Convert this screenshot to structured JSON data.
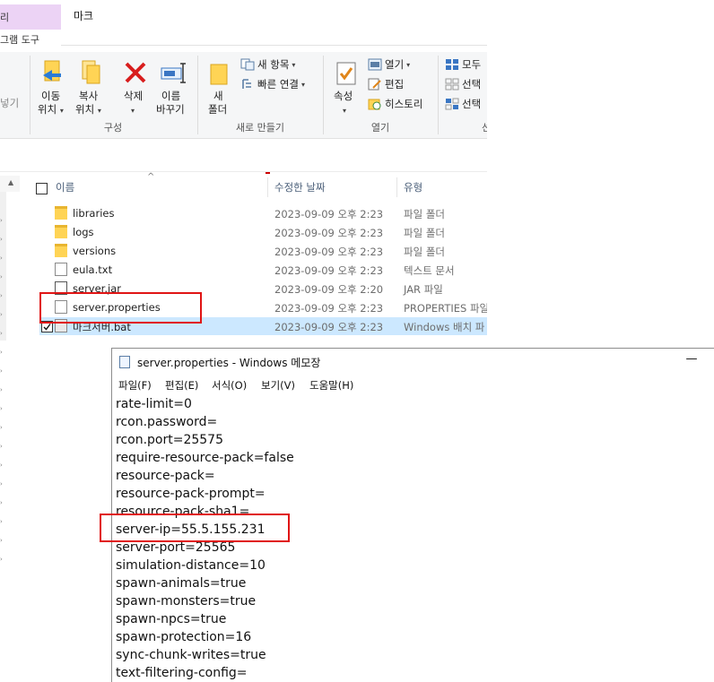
{
  "explorer": {
    "context_tab": {
      "header": "리",
      "label": "그램 도구"
    },
    "title": "마크",
    "ribbon": {
      "partial_left": "넣기",
      "move_to": [
        "이동",
        "위치"
      ],
      "copy_to": [
        "복사",
        "위치"
      ],
      "delete": "삭제",
      "rename": [
        "이름",
        "바꾸기"
      ],
      "new_folder": [
        "새",
        "폴더"
      ],
      "new_item": "새 항목",
      "easy_access": "빠른 연결",
      "properties": "속성",
      "open": "열기",
      "edit": "편집",
      "history": "히스토리",
      "select_all": "모두",
      "select_none": "선택",
      "invert_selection": "선택",
      "groups": {
        "organize": "구성",
        "new": "새로 만들기",
        "open": "열기",
        "select": "선"
      }
    },
    "columns": {
      "name": "이름",
      "date": "수정한 날짜",
      "type": "유형"
    },
    "files": [
      {
        "name": "libraries",
        "date": "2023-09-09 오후 2:23",
        "type": "파일 폴더",
        "icon": "folder-icon"
      },
      {
        "name": "logs",
        "date": "2023-09-09 오후 2:23",
        "type": "파일 폴더",
        "icon": "folder-icon"
      },
      {
        "name": "versions",
        "date": "2023-09-09 오후 2:23",
        "type": "파일 폴더",
        "icon": "folder-icon"
      },
      {
        "name": "eula.txt",
        "date": "2023-09-09 오후 2:23",
        "type": "텍스트 문서",
        "icon": "text-file-icon"
      },
      {
        "name": "server.jar",
        "date": "2023-09-09 오후 2:20",
        "type": "JAR 파일",
        "icon": "jar-file-icon"
      },
      {
        "name": "server.properties",
        "date": "2023-09-09 오후 2:23",
        "type": "PROPERTIES 파일",
        "icon": "properties-file-icon"
      },
      {
        "name": "마크서버.bat",
        "date": "2023-09-09 오후 2:23",
        "type": "Windows 배치 파",
        "icon": "batch-file-icon"
      }
    ]
  },
  "notepad": {
    "title": "server.properties - Windows 메모장",
    "minimize": "—",
    "menu": [
      "파일(F)",
      "편집(E)",
      "서식(O)",
      "보기(V)",
      "도움말(H)"
    ],
    "lines": [
      "rate-limit=0",
      "rcon.password=",
      "rcon.port=25575",
      "require-resource-pack=false",
      "resource-pack=",
      "resource-pack-prompt=",
      "resource-pack-sha1=",
      "server-ip=55.5.155.231",
      "server-port=25565",
      "simulation-distance=10",
      "spawn-animals=true",
      "spawn-monsters=true",
      "spawn-npcs=true",
      "spawn-protection=16",
      "sync-chunk-writes=true",
      "text-filtering-config="
    ]
  },
  "colors": {
    "highlight_box": "#e01414",
    "selected_row": "#cce8ff",
    "context_tab": "#ecd3f5"
  }
}
